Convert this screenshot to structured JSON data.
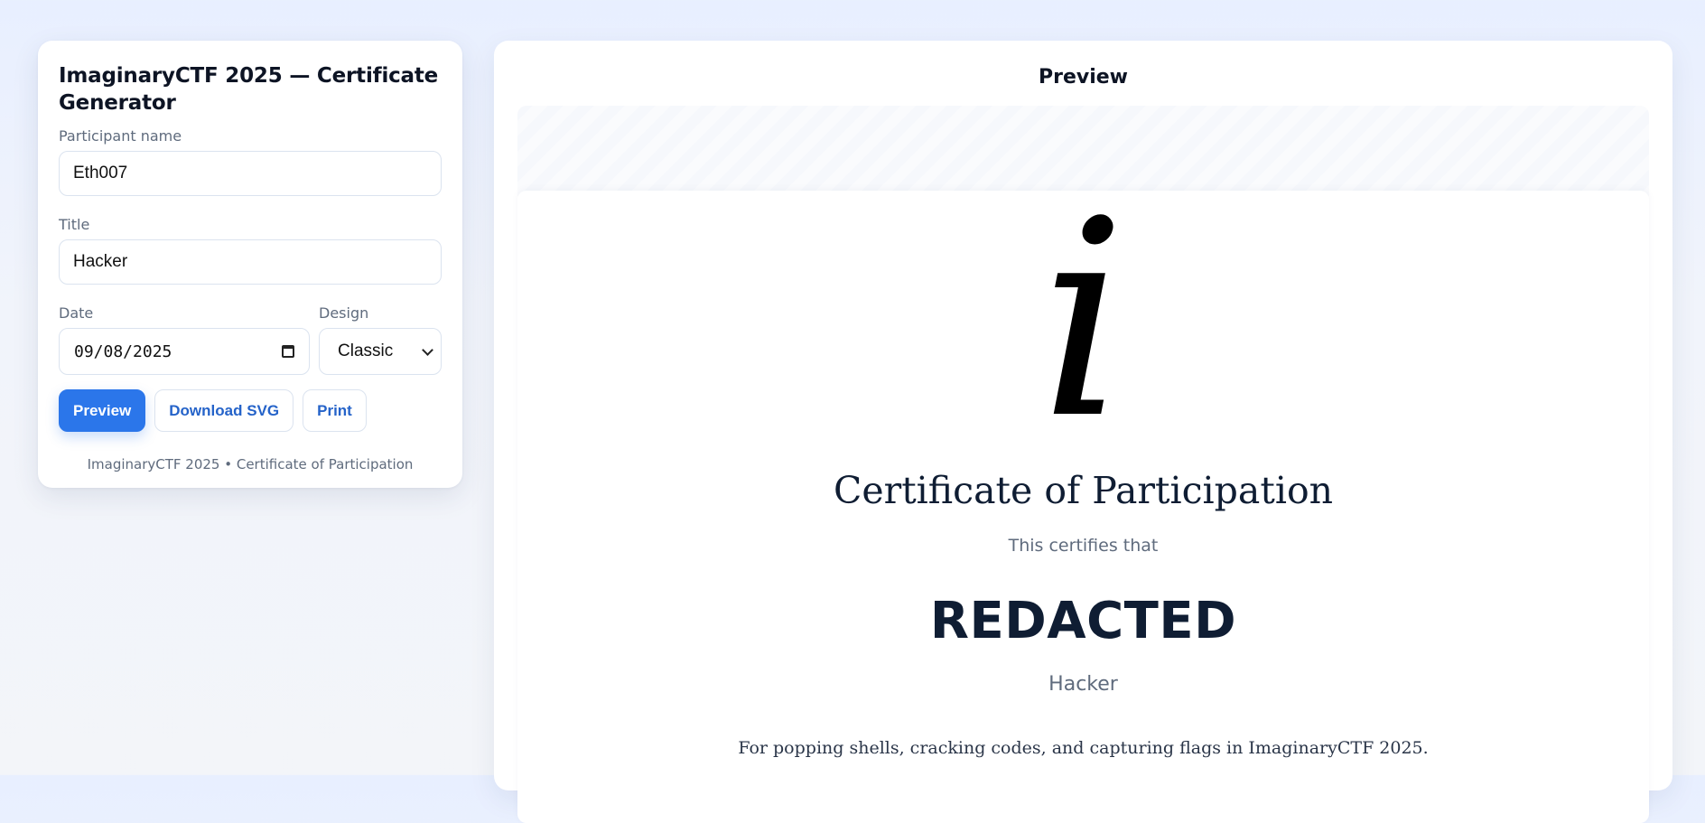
{
  "form": {
    "title": "ImaginaryCTF 2025 — Certificate Generator",
    "participant_label": "Participant name",
    "participant_value": "Eth007",
    "title_label": "Title",
    "title_value": "Hacker",
    "date_label": "Date",
    "date_value": "09/08/2025",
    "design_label": "Design",
    "design_value": "Classic",
    "buttons": {
      "preview": "Preview",
      "download": "Download SVG",
      "print": "Print"
    },
    "footer": "ImaginaryCTF 2025 • Certificate of Participation"
  },
  "preview": {
    "heading": "Preview",
    "mark": "i",
    "cert_title": "Certificate of Participation",
    "certifies": "This certifies that",
    "name": "REDACTED",
    "role": "Hacker",
    "description": "For popping shells, cracking codes, and capturing flags in ImaginaryCTF 2025."
  },
  "colors": {
    "primary": "#2b76ea",
    "link": "#2563c9",
    "text_dark": "#0f1d33",
    "muted": "#5f6b7d"
  },
  "icons": {
    "date_picker": "calendar-icon",
    "design_select": "chevron-down-icon"
  }
}
